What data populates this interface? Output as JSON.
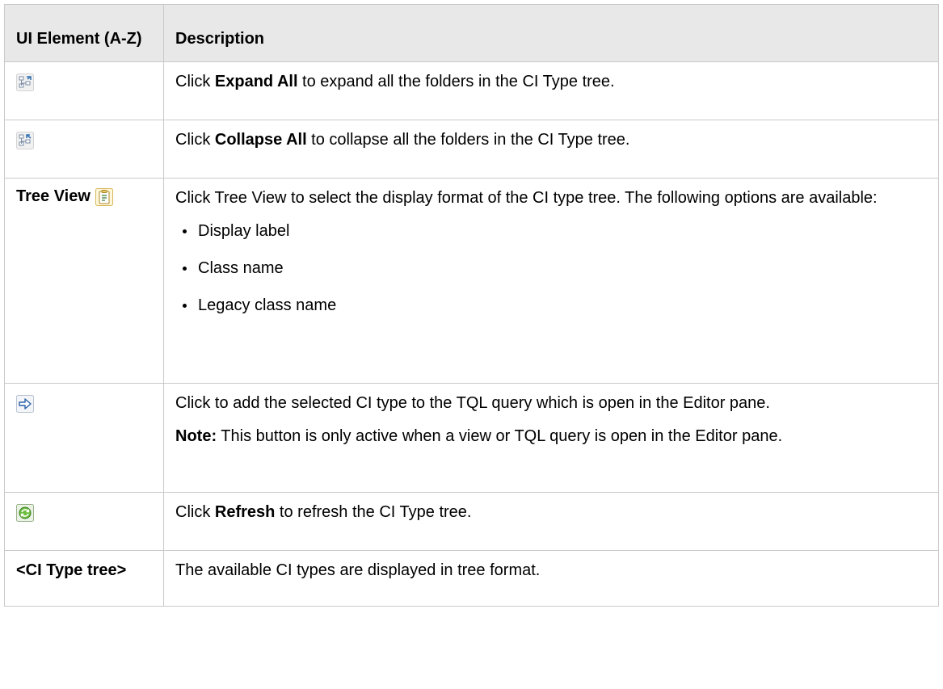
{
  "table": {
    "header": {
      "col1": "UI Element (A-Z)",
      "col2": "Description"
    },
    "rows": [
      {
        "icon": "expand-all-icon",
        "desc_pre": "Click ",
        "desc_bold": "Expand All",
        "desc_post": " to expand all the folders in the CI Type tree."
      },
      {
        "icon": "collapse-all-icon",
        "desc_pre": "Click ",
        "desc_bold": "Collapse All",
        "desc_post": " to collapse all the folders in the CI Type tree."
      },
      {
        "label": "Tree View",
        "icon": "tree-view-icon",
        "desc": "Click Tree View to select the display format of the CI type tree. The following options are available:",
        "options": [
          "Display label",
          "Class name",
          "Legacy class name"
        ]
      },
      {
        "icon": "add-to-query-arrow-icon",
        "desc": "Click to add the selected CI type to the TQL query which is open in the Editor pane.",
        "note_label": "Note:",
        "note_text": " This button is only active when a view or TQL query is open in the Editor pane."
      },
      {
        "icon": "refresh-icon",
        "desc_pre": "Click ",
        "desc_bold": "Refresh",
        "desc_post": " to refresh the CI Type tree."
      },
      {
        "label": "<CI Type tree>",
        "desc": "The available CI types are displayed in tree format."
      }
    ]
  }
}
